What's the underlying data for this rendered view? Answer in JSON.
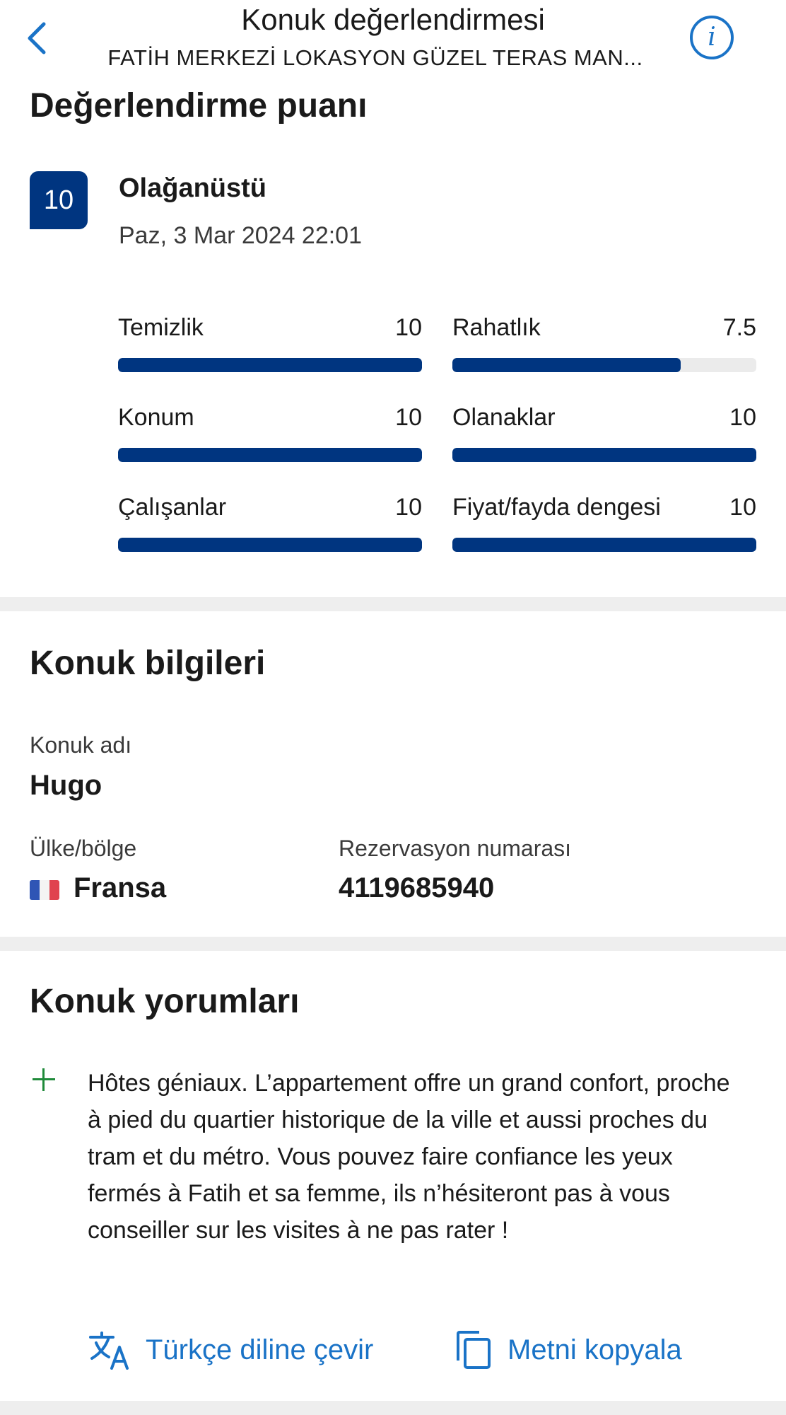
{
  "header": {
    "title": "Konuk değerlendirmesi",
    "subtitle": "FATİH MERKEZİ LOKASYON GÜZEL TERAS MAN..."
  },
  "rating": {
    "section_title": "Değerlendirme puanı",
    "score": "10",
    "score_label": "Olağanüstü",
    "date": "Paz, 3 Mar 2024 22:01",
    "categories": [
      {
        "name": "Temizlik",
        "value": "10",
        "fraction": 1.0
      },
      {
        "name": "Rahatlık",
        "value": "7.5",
        "fraction": 0.75
      },
      {
        "name": "Konum",
        "value": "10",
        "fraction": 1.0
      },
      {
        "name": "Olanaklar",
        "value": "10",
        "fraction": 1.0
      },
      {
        "name": "Çalışanlar",
        "value": "10",
        "fraction": 1.0
      },
      {
        "name": "Fiyat/fayda dengesi",
        "value": "10",
        "fraction": 1.0
      }
    ],
    "bar_color": "#003580",
    "track_color": "#ebebeb"
  },
  "guest": {
    "section_title": "Konuk bilgileri",
    "name_label": "Konuk adı",
    "name": "Hugo",
    "country_label": "Ülke/bölge",
    "country": "Fransa",
    "country_flag": "flag-france-icon",
    "reservation_label": "Rezervasyon numarası",
    "reservation_number": "4119685940"
  },
  "comments": {
    "section_title": "Konuk yorumları",
    "positive_icon": "plus-icon",
    "positive_text": "Hôtes géniaux. L’appartement offre un grand confort, proche à pied du quartier historique de la ville et aussi proches du tram et du métro. Vous pouvez faire confiance les yeux fermés à Fatih et sa femme, ils n’hésiteront pas à vous conseiller sur les visites à ne pas rater !",
    "translate_label": "Türkçe diline çevir",
    "copy_label": "Metni kopyala"
  },
  "colors": {
    "accent": "#1a73c7",
    "brand": "#003580",
    "positive": "#1f8a3a"
  }
}
